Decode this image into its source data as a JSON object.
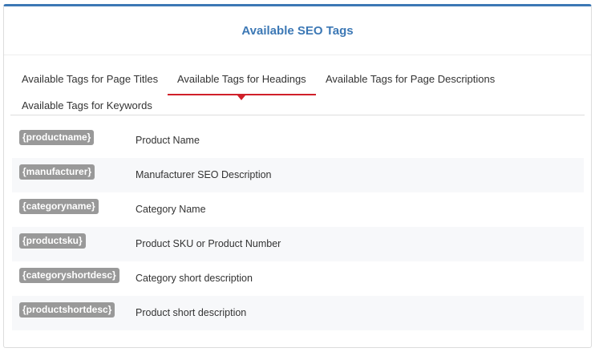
{
  "panel": {
    "title": "Available SEO Tags"
  },
  "tabs": [
    {
      "label": "Available Tags for Page Titles",
      "active": false
    },
    {
      "label": "Available Tags for Headings",
      "active": true
    },
    {
      "label": "Available Tags for Page Descriptions",
      "active": false
    },
    {
      "label": "Available Tags for Keywords",
      "active": false
    }
  ],
  "tags": [
    {
      "tag": "{productname}",
      "description": "Product Name"
    },
    {
      "tag": "{manufacturer}",
      "description": "Manufacturer SEO Description"
    },
    {
      "tag": "{categoryname}",
      "description": "Category Name"
    },
    {
      "tag": "{productsku}",
      "description": "Product SKU or Product Number"
    },
    {
      "tag": "{categoryshortdesc}",
      "description": "Category short description"
    },
    {
      "tag": "{productshortdesc}",
      "description": "Product short description"
    }
  ],
  "colors": {
    "accent": "#3c78b5",
    "active_tab": "#d0202a",
    "badge": "#999999"
  }
}
